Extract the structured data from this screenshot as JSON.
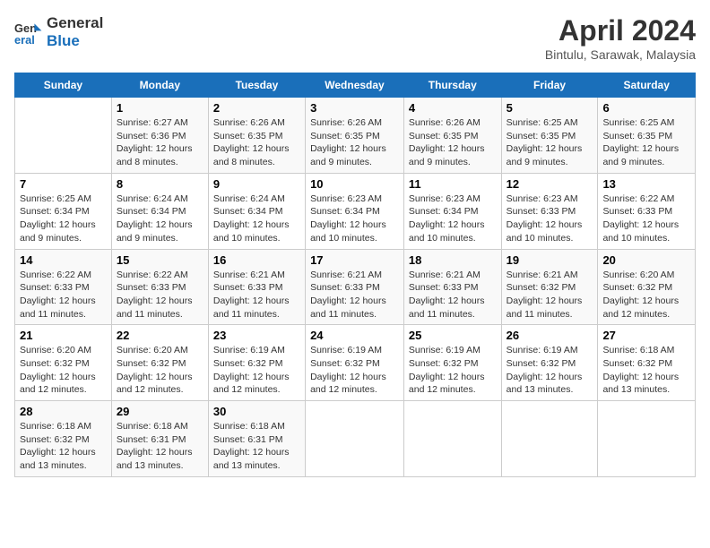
{
  "logo": {
    "text_general": "General",
    "text_blue": "Blue"
  },
  "title": "April 2024",
  "subtitle": "Bintulu, Sarawak, Malaysia",
  "days_of_week": [
    "Sunday",
    "Monday",
    "Tuesday",
    "Wednesday",
    "Thursday",
    "Friday",
    "Saturday"
  ],
  "weeks": [
    [
      {
        "day": "",
        "sunrise": "",
        "sunset": "",
        "daylight": ""
      },
      {
        "day": "1",
        "sunrise": "Sunrise: 6:27 AM",
        "sunset": "Sunset: 6:36 PM",
        "daylight": "Daylight: 12 hours and 8 minutes."
      },
      {
        "day": "2",
        "sunrise": "Sunrise: 6:26 AM",
        "sunset": "Sunset: 6:35 PM",
        "daylight": "Daylight: 12 hours and 8 minutes."
      },
      {
        "day": "3",
        "sunrise": "Sunrise: 6:26 AM",
        "sunset": "Sunset: 6:35 PM",
        "daylight": "Daylight: 12 hours and 9 minutes."
      },
      {
        "day": "4",
        "sunrise": "Sunrise: 6:26 AM",
        "sunset": "Sunset: 6:35 PM",
        "daylight": "Daylight: 12 hours and 9 minutes."
      },
      {
        "day": "5",
        "sunrise": "Sunrise: 6:25 AM",
        "sunset": "Sunset: 6:35 PM",
        "daylight": "Daylight: 12 hours and 9 minutes."
      },
      {
        "day": "6",
        "sunrise": "Sunrise: 6:25 AM",
        "sunset": "Sunset: 6:35 PM",
        "daylight": "Daylight: 12 hours and 9 minutes."
      }
    ],
    [
      {
        "day": "7",
        "sunrise": "Sunrise: 6:25 AM",
        "sunset": "Sunset: 6:34 PM",
        "daylight": "Daylight: 12 hours and 9 minutes."
      },
      {
        "day": "8",
        "sunrise": "Sunrise: 6:24 AM",
        "sunset": "Sunset: 6:34 PM",
        "daylight": "Daylight: 12 hours and 9 minutes."
      },
      {
        "day": "9",
        "sunrise": "Sunrise: 6:24 AM",
        "sunset": "Sunset: 6:34 PM",
        "daylight": "Daylight: 12 hours and 10 minutes."
      },
      {
        "day": "10",
        "sunrise": "Sunrise: 6:23 AM",
        "sunset": "Sunset: 6:34 PM",
        "daylight": "Daylight: 12 hours and 10 minutes."
      },
      {
        "day": "11",
        "sunrise": "Sunrise: 6:23 AM",
        "sunset": "Sunset: 6:34 PM",
        "daylight": "Daylight: 12 hours and 10 minutes."
      },
      {
        "day": "12",
        "sunrise": "Sunrise: 6:23 AM",
        "sunset": "Sunset: 6:33 PM",
        "daylight": "Daylight: 12 hours and 10 minutes."
      },
      {
        "day": "13",
        "sunrise": "Sunrise: 6:22 AM",
        "sunset": "Sunset: 6:33 PM",
        "daylight": "Daylight: 12 hours and 10 minutes."
      }
    ],
    [
      {
        "day": "14",
        "sunrise": "Sunrise: 6:22 AM",
        "sunset": "Sunset: 6:33 PM",
        "daylight": "Daylight: 12 hours and 11 minutes."
      },
      {
        "day": "15",
        "sunrise": "Sunrise: 6:22 AM",
        "sunset": "Sunset: 6:33 PM",
        "daylight": "Daylight: 12 hours and 11 minutes."
      },
      {
        "day": "16",
        "sunrise": "Sunrise: 6:21 AM",
        "sunset": "Sunset: 6:33 PM",
        "daylight": "Daylight: 12 hours and 11 minutes."
      },
      {
        "day": "17",
        "sunrise": "Sunrise: 6:21 AM",
        "sunset": "Sunset: 6:33 PM",
        "daylight": "Daylight: 12 hours and 11 minutes."
      },
      {
        "day": "18",
        "sunrise": "Sunrise: 6:21 AM",
        "sunset": "Sunset: 6:33 PM",
        "daylight": "Daylight: 12 hours and 11 minutes."
      },
      {
        "day": "19",
        "sunrise": "Sunrise: 6:21 AM",
        "sunset": "Sunset: 6:32 PM",
        "daylight": "Daylight: 12 hours and 11 minutes."
      },
      {
        "day": "20",
        "sunrise": "Sunrise: 6:20 AM",
        "sunset": "Sunset: 6:32 PM",
        "daylight": "Daylight: 12 hours and 12 minutes."
      }
    ],
    [
      {
        "day": "21",
        "sunrise": "Sunrise: 6:20 AM",
        "sunset": "Sunset: 6:32 PM",
        "daylight": "Daylight: 12 hours and 12 minutes."
      },
      {
        "day": "22",
        "sunrise": "Sunrise: 6:20 AM",
        "sunset": "Sunset: 6:32 PM",
        "daylight": "Daylight: 12 hours and 12 minutes."
      },
      {
        "day": "23",
        "sunrise": "Sunrise: 6:19 AM",
        "sunset": "Sunset: 6:32 PM",
        "daylight": "Daylight: 12 hours and 12 minutes."
      },
      {
        "day": "24",
        "sunrise": "Sunrise: 6:19 AM",
        "sunset": "Sunset: 6:32 PM",
        "daylight": "Daylight: 12 hours and 12 minutes."
      },
      {
        "day": "25",
        "sunrise": "Sunrise: 6:19 AM",
        "sunset": "Sunset: 6:32 PM",
        "daylight": "Daylight: 12 hours and 12 minutes."
      },
      {
        "day": "26",
        "sunrise": "Sunrise: 6:19 AM",
        "sunset": "Sunset: 6:32 PM",
        "daylight": "Daylight: 12 hours and 13 minutes."
      },
      {
        "day": "27",
        "sunrise": "Sunrise: 6:18 AM",
        "sunset": "Sunset: 6:32 PM",
        "daylight": "Daylight: 12 hours and 13 minutes."
      }
    ],
    [
      {
        "day": "28",
        "sunrise": "Sunrise: 6:18 AM",
        "sunset": "Sunset: 6:32 PM",
        "daylight": "Daylight: 12 hours and 13 minutes."
      },
      {
        "day": "29",
        "sunrise": "Sunrise: 6:18 AM",
        "sunset": "Sunset: 6:31 PM",
        "daylight": "Daylight: 12 hours and 13 minutes."
      },
      {
        "day": "30",
        "sunrise": "Sunrise: 6:18 AM",
        "sunset": "Sunset: 6:31 PM",
        "daylight": "Daylight: 12 hours and 13 minutes."
      },
      {
        "day": "",
        "sunrise": "",
        "sunset": "",
        "daylight": ""
      },
      {
        "day": "",
        "sunrise": "",
        "sunset": "",
        "daylight": ""
      },
      {
        "day": "",
        "sunrise": "",
        "sunset": "",
        "daylight": ""
      },
      {
        "day": "",
        "sunrise": "",
        "sunset": "",
        "daylight": ""
      }
    ]
  ]
}
